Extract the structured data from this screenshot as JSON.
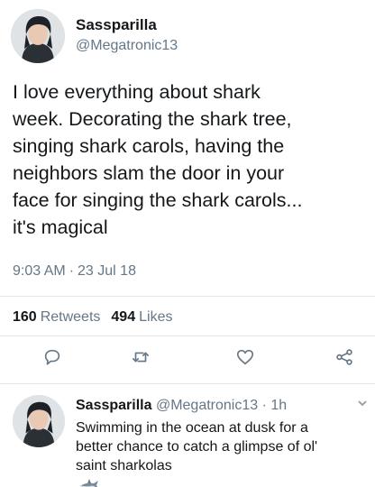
{
  "tweet": {
    "name": "Sassparilla",
    "handle": "@Megatronic13",
    "text_lines": [
      "I love everything about shark",
      "week. Decorating the shark tree,",
      "singing shark carols, having the",
      "neighbors slam the door in your",
      "face for singing the shark carols...",
      "it's magical"
    ],
    "time": "9:03 AM",
    "separator": "·",
    "date": "23 Jul 18",
    "retweets_count": "160",
    "retweets_label": "Retweets",
    "likes_count": "494",
    "likes_label": "Likes",
    "actions": [
      "reply-icon",
      "retweet-icon",
      "like-icon",
      "share-icon"
    ]
  },
  "reply": {
    "name": "Sassparilla",
    "handle": "@Megatronic13",
    "separator": "·",
    "time": "1h",
    "text_lines": [
      "Swimming in the ocean at dusk for a",
      "better chance to catch a glimpse of ol'",
      "saint sharkolas"
    ],
    "emoji": "shark-emoji"
  },
  "colors": {
    "text": "#14171a",
    "secondary": "#657786",
    "divider": "#e1e8ed",
    "background": "#ffffff"
  }
}
